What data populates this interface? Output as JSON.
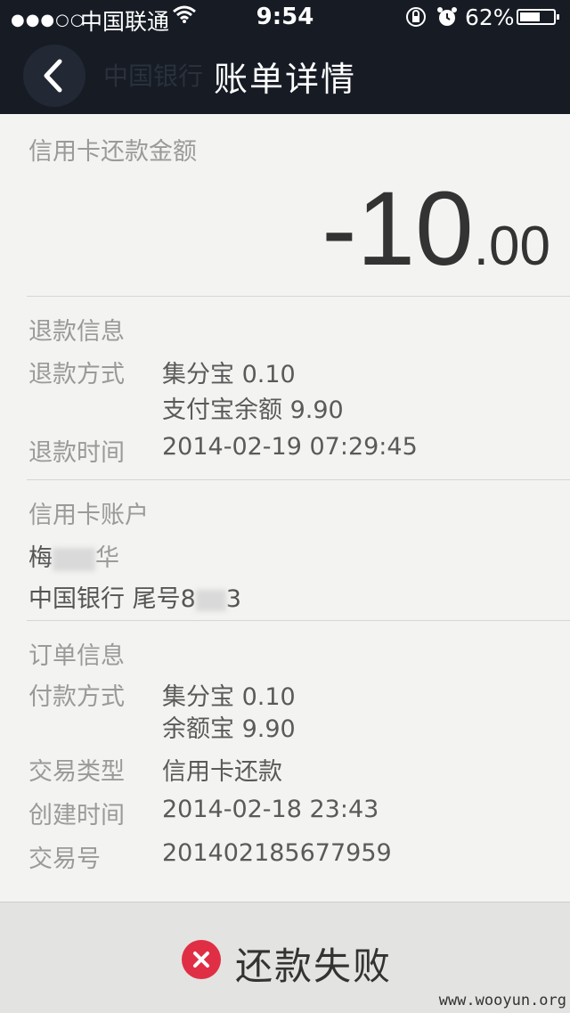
{
  "status_bar": {
    "signal": "●●●○○",
    "carrier": "中国联通",
    "time": "9:54",
    "battery_percent_text": "62%",
    "battery_level": 0.62
  },
  "nav": {
    "bank_name": "中国银行",
    "title": "账单详情"
  },
  "summary": {
    "label": "信用卡还款金额",
    "amount_int": "-10",
    "amount_dec": ".00"
  },
  "refund": {
    "heading": "退款信息",
    "method_label": "退款方式",
    "method_line1": "集分宝 0.10",
    "method_line2": "支付宝余额 9.90",
    "time_label": "退款时间",
    "time_value": "2014-02-19 07:29:45"
  },
  "account": {
    "heading": "信用卡账户",
    "holder_visible_start": "梅",
    "holder_visible_end": "华",
    "bank_prefix": "中国银行 尾号8",
    "bank_suffix": "3"
  },
  "order": {
    "heading": "订单信息",
    "pay_label": "付款方式",
    "pay_line1": "集分宝 0.10",
    "pay_line2": "余额宝 9.90",
    "type_label": "交易类型",
    "type_value": "信用卡还款",
    "created_label": "创建时间",
    "created_value": "2014-02-18 23:43",
    "trade_no_label": "交易号",
    "trade_no_value": "201402185677959"
  },
  "result": {
    "text": "还款失败",
    "icon": "close-icon",
    "color": "#e02f45"
  },
  "watermark": "www.wooyun.org"
}
